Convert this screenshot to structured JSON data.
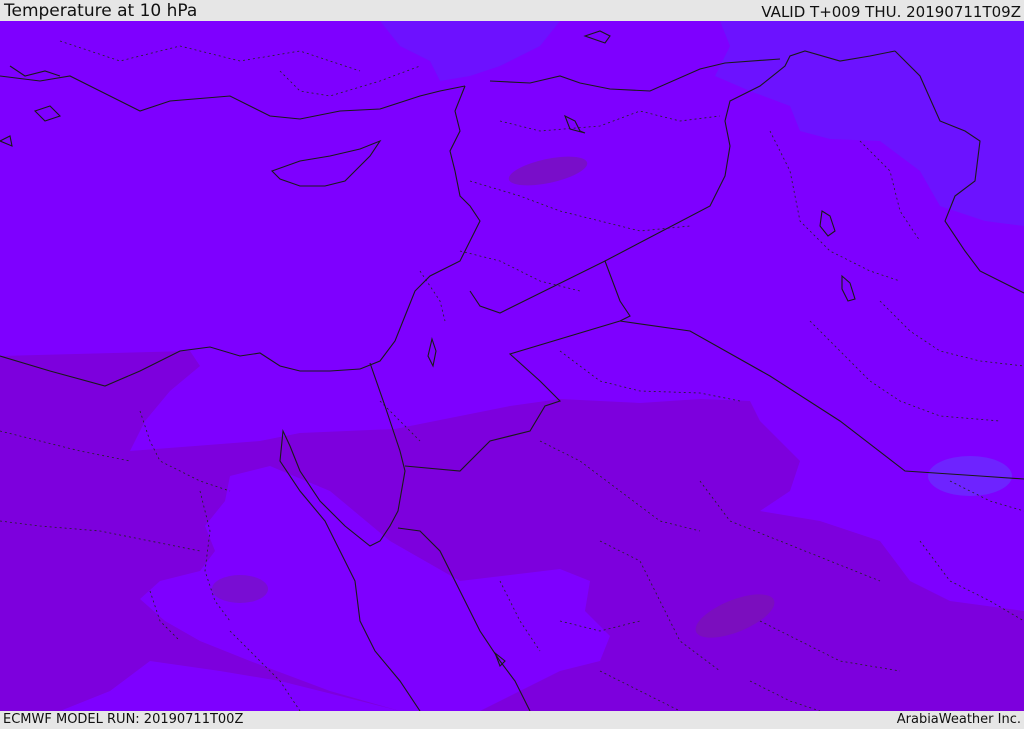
{
  "header": {
    "title": "Temperature at 10 hPa",
    "valid_time": "VALID T+009 THU. 20190711T09Z"
  },
  "footer": {
    "model_run": "ECMWF MODEL RUN: 20190711T00Z",
    "credit": "ArabiaWeather Inc."
  },
  "map": {
    "variable": "temperature",
    "level": "10 hPa",
    "colors": {
      "base_violet": "#7e00ff",
      "cooler_blue_violet": "#6a14ff",
      "warmer_purple": "#7f00dd",
      "warm_spot": "#7a10b8",
      "borders": "#1a1a1a",
      "header_bg": "#e6e6e6"
    }
  }
}
